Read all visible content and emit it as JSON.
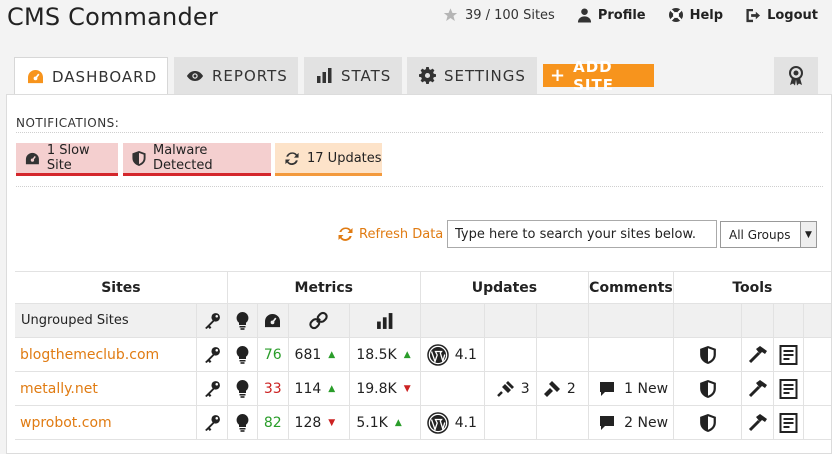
{
  "app": {
    "title": "CMS Commander"
  },
  "header": {
    "sites_count": "39 / 100 Sites",
    "profile": "Profile",
    "help": "Help",
    "logout": "Logout"
  },
  "tabs": [
    {
      "label": "DASHBOARD",
      "icon": "gauge-icon",
      "active": true
    },
    {
      "label": "REPORTS",
      "icon": "eye-icon"
    },
    {
      "label": "STATS",
      "icon": "bar-chart-icon"
    },
    {
      "label": "SETTINGS",
      "icon": "gear-icon"
    }
  ],
  "add_site": "ADD SITE",
  "notifications": {
    "label": "NOTIFICATIONS:",
    "items": [
      {
        "label": "1 Slow Site",
        "color": "#d4272c"
      },
      {
        "label": "Malware Detected",
        "color": "#d4272c"
      },
      {
        "label": "17 Updates",
        "color": "#f39a3d"
      }
    ]
  },
  "toolbar": {
    "refresh": "Refresh Data",
    "search_placeholder": "Type here to search your sites below.",
    "group_selected": "All Groups"
  },
  "table": {
    "headers": {
      "sites": "Sites",
      "metrics": "Metrics",
      "updates": "Updates",
      "comments": "Comments",
      "tools": "Tools"
    },
    "group_name": "Ungrouped Sites",
    "rows": [
      {
        "site": "blogthemeclub.com",
        "speed": "76",
        "speed_status": "good",
        "links": "681",
        "links_trend": "up",
        "traffic": "18.5K",
        "traffic_trend": "up",
        "wp_version": "4.1",
        "plugins": "",
        "themes": "",
        "comments": ""
      },
      {
        "site": "metally.net",
        "speed": "33",
        "speed_status": "bad",
        "links": "114",
        "links_trend": "up",
        "traffic": "19.8K",
        "traffic_trend": "down",
        "wp_version": "",
        "plugins": "3",
        "themes": "2",
        "comments": "1 New"
      },
      {
        "site": "wprobot.com",
        "speed": "82",
        "speed_status": "good",
        "links": "128",
        "links_trend": "down",
        "traffic": "5.1K",
        "traffic_trend": "up",
        "wp_version": "4.1",
        "plugins": "",
        "themes": "",
        "comments": "2 New"
      }
    ]
  },
  "colors": {
    "accent": "#f7941d",
    "link": "#e07b12",
    "good": "#2a9d2a",
    "bad": "#cc2222"
  }
}
